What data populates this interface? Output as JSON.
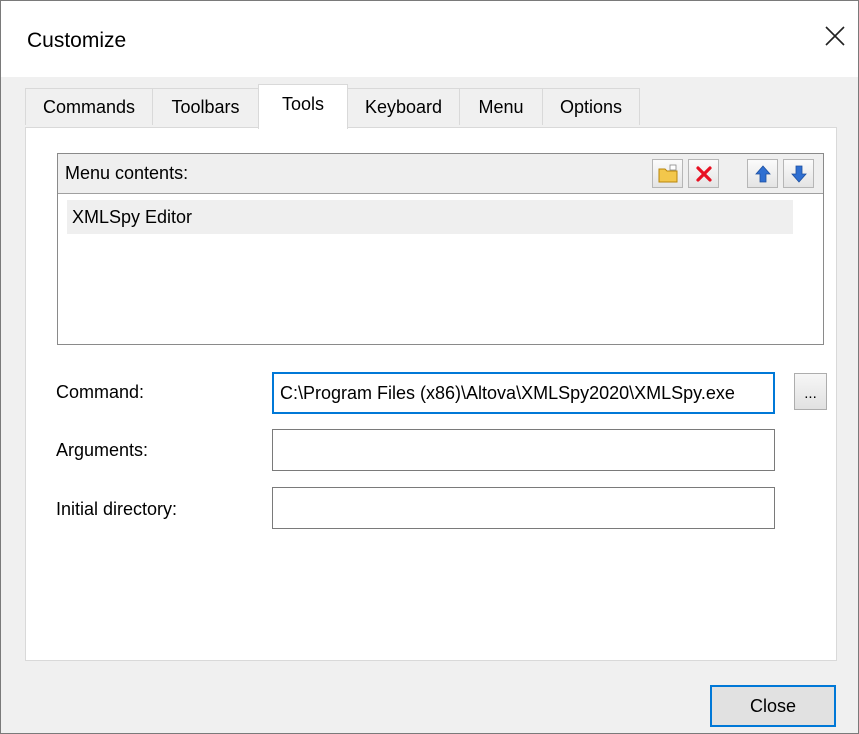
{
  "window": {
    "title": "Customize",
    "close_glyph": "×"
  },
  "tabs": [
    {
      "label": "Commands"
    },
    {
      "label": "Toolbars"
    },
    {
      "label": "Tools",
      "active": true
    },
    {
      "label": "Keyboard"
    },
    {
      "label": "Menu"
    },
    {
      "label": "Options"
    }
  ],
  "menu_contents": {
    "label": "Menu contents:",
    "toolbar_icons": [
      "new-folder-icon",
      "delete-icon",
      "move-up-icon",
      "move-down-icon"
    ],
    "items": [
      "XMLSpy Editor"
    ]
  },
  "fields": {
    "command": {
      "label": "Command:",
      "value": "C:\\Program Files (x86)\\Altova\\XMLSpy2020\\XMLSpy.exe"
    },
    "arguments": {
      "label": "Arguments:",
      "value": ""
    },
    "initial_directory": {
      "label": "Initial directory:",
      "value": ""
    }
  },
  "browse_button": {
    "label": "..."
  },
  "footer": {
    "close_label": "Close"
  },
  "colors": {
    "accent": "#0078d7",
    "delete_red": "#e81123",
    "arrow_blue": "#2f6fd1",
    "folder_yellow": "#f3c74b"
  }
}
